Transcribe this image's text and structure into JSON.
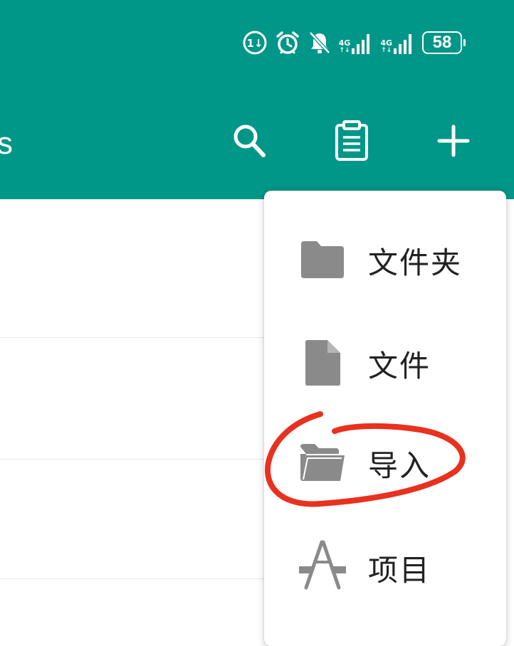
{
  "status_bar": {
    "network1_label": "4G",
    "network2_label": "4G",
    "battery_level": "58",
    "icons": [
      "data-usage-icon",
      "alarm-icon",
      "bell-off-icon",
      "signal-icon",
      "signal-icon",
      "battery-icon"
    ]
  },
  "toolbar": {
    "title_fragment": "s",
    "background_color": "#009688",
    "icons": [
      "search-icon",
      "clipboard-icon",
      "add-icon"
    ]
  },
  "menu": {
    "items": [
      {
        "label": "文件夹",
        "icon": "folder-icon"
      },
      {
        "label": "文件",
        "icon": "file-icon"
      },
      {
        "label": "导入",
        "icon": "folder-open-icon"
      },
      {
        "label": "项目",
        "icon": "app-store-icon"
      }
    ],
    "highlighted_item": "导入",
    "highlight_color": "#e8311f"
  }
}
